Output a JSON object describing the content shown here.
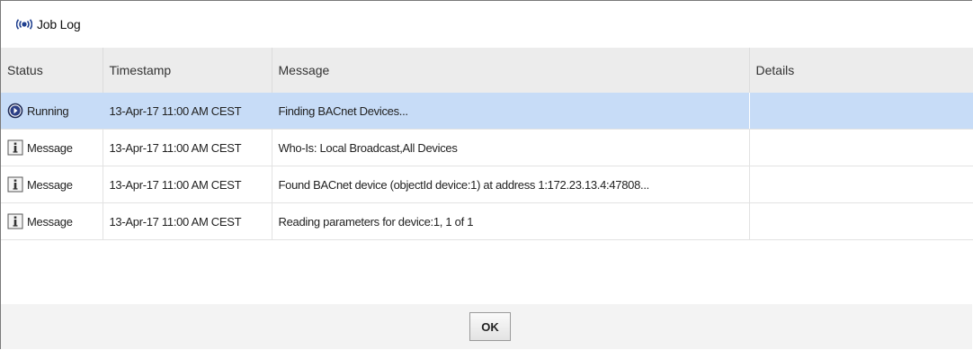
{
  "window": {
    "title": "Job Log",
    "icon": "broadcast-icon"
  },
  "table": {
    "columns": [
      "Status",
      "Timestamp",
      "Message",
      "Details"
    ],
    "rows": [
      {
        "status": "Running",
        "status_icon": "running-icon",
        "timestamp": "13-Apr-17 11:00 AM CEST",
        "message": "Finding BACnet Devices...",
        "details": "",
        "selected": true
      },
      {
        "status": "Message",
        "status_icon": "info-icon",
        "timestamp": "13-Apr-17 11:00 AM CEST",
        "message": "Who-Is: Local Broadcast,All Devices",
        "details": ""
      },
      {
        "status": "Message",
        "status_icon": "info-icon",
        "timestamp": "13-Apr-17 11:00 AM CEST",
        "message": "Found BACnet device (objectId device:1) at address 1:172.23.13.4:47808...",
        "details": ""
      },
      {
        "status": "Message",
        "status_icon": "info-icon",
        "timestamp": "13-Apr-17 11:00 AM CEST",
        "message": "Reading parameters for device:1, 1 of 1",
        "details": ""
      }
    ]
  },
  "footer": {
    "ok_label": "OK"
  },
  "colors": {
    "selected_row": "#c7dcf7",
    "header_bg": "#ececec",
    "accent": "#1f3f8f"
  }
}
